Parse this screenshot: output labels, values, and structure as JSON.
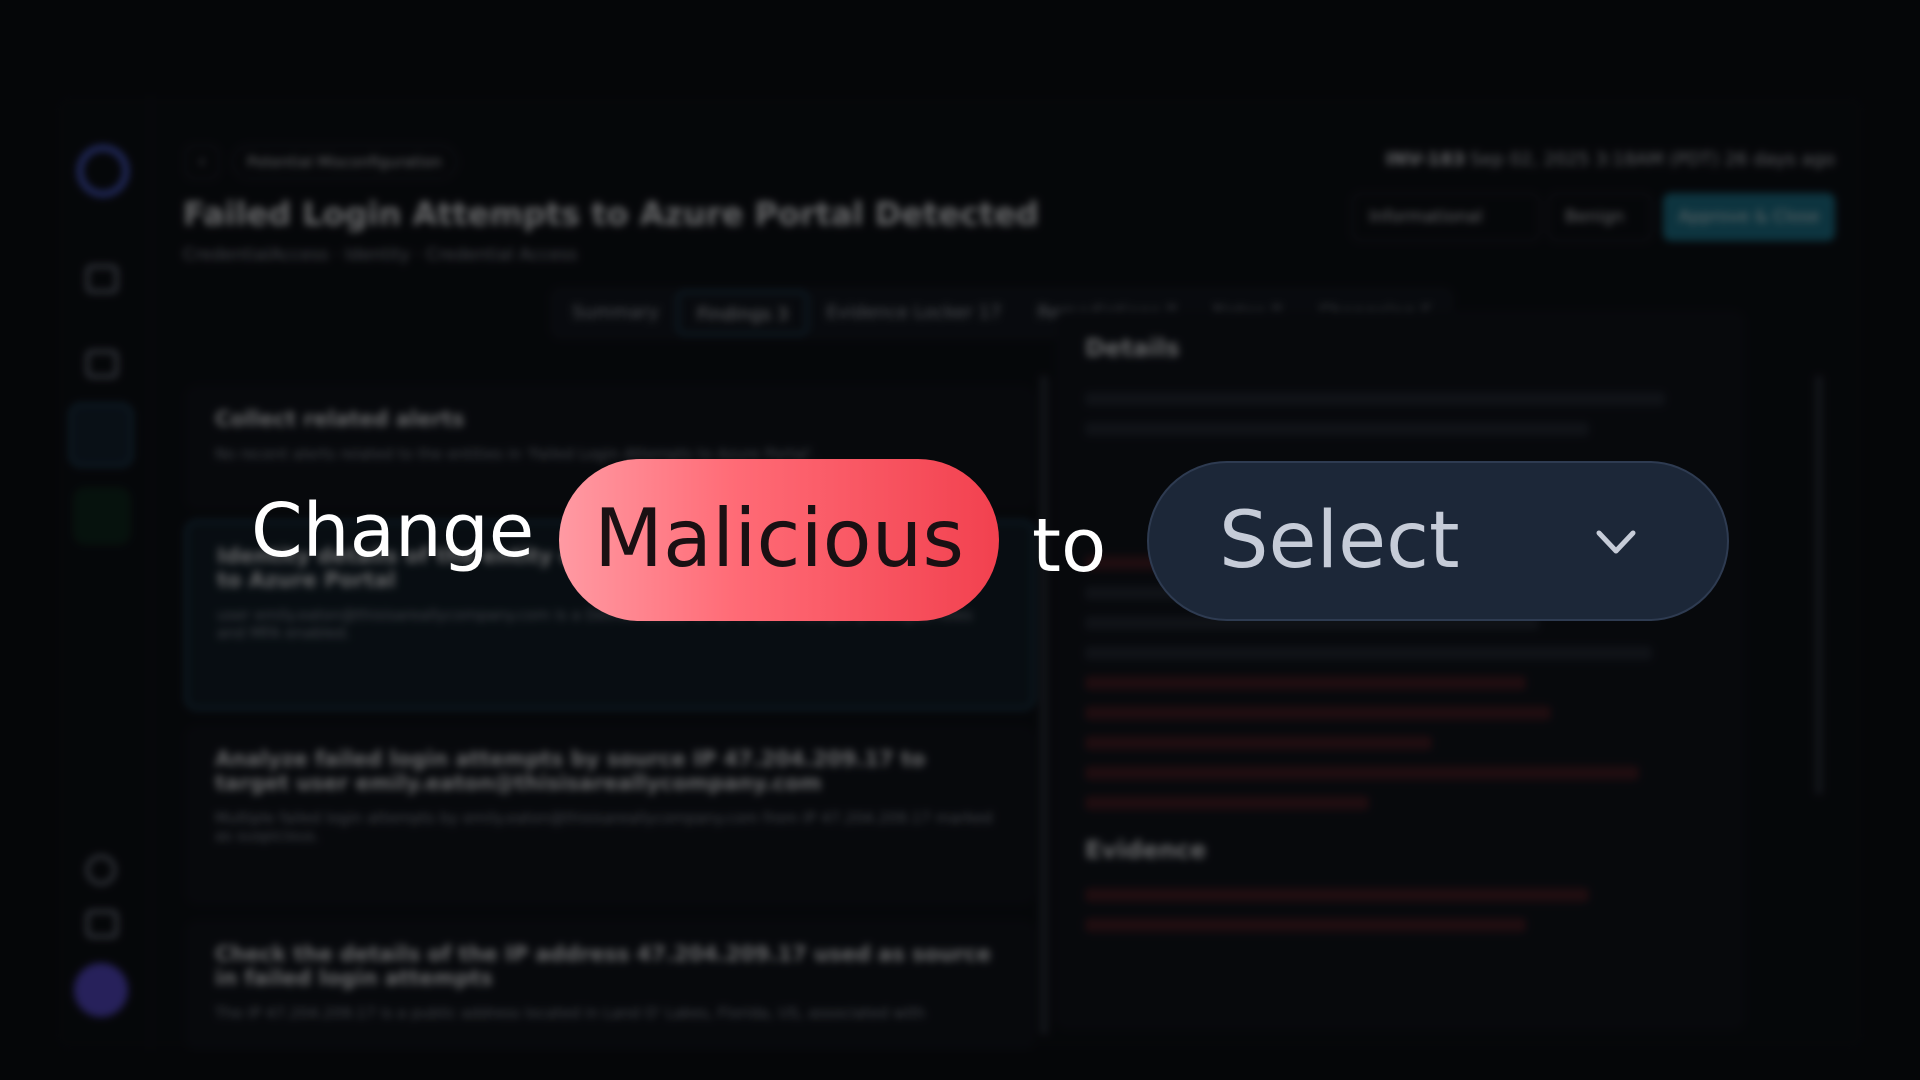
{
  "background_app": {
    "page": {
      "tag": "Potential Misconfiguration",
      "title": "Failed Login Attempts to Azure Portal Detected",
      "subtitle": "CredentialAccess · Identity · Credential Access",
      "severity": "INV-183",
      "date": "Sep 02, 2025 3:18AM (PDT) 26 days ago",
      "dropdown_1": "Informational",
      "dropdown_2": "Benign",
      "primary_button": "Approve & Close"
    },
    "tabs": [
      {
        "label": "Summary"
      },
      {
        "label": "Findings 3"
      },
      {
        "label": "Evidence Locker 17"
      },
      {
        "label": "Remediations 0"
      },
      {
        "label": "Notes 0"
      },
      {
        "label": "Changelog 6"
      }
    ],
    "cards": [
      {
        "title": "Collect related alerts",
        "body": "No recent alerts related to the entities in 'Failed Login Attempts to Azure Portal'."
      },
      {
        "title": "Identity details of the entity emily.eaton — failed login attempts to Azure Portal",
        "body": "user emily.eaton@thisisareallycompany.com is a Detroit-based VP of IT with multiple privileged roles and MFA enabled."
      },
      {
        "title": "Analyze failed login attempts by source IP 47.204.209.17 to target user emily.eaton@thisisareallycompany.com",
        "body": "Multiple failed login attempts by emily.eaton@thisisareallycompany.com from IP 47.204.209.17 marked as suspicious."
      },
      {
        "title": "Check the details of the IP address 47.204.209.17 used as source in failed login attempts",
        "body": "The IP 47.204.209.17 is a public address located in Land O' Lakes, Florida, US, associated with"
      }
    ],
    "details": {
      "heading": "Details",
      "evidence_heading": "Evidence"
    }
  },
  "overlay": {
    "change_label": "Change",
    "from_value": "Malicious",
    "to_label": "to",
    "select_placeholder": "Select"
  },
  "colors": {
    "malicious_gradient_start": "#ff9aa3",
    "malicious_gradient_end": "#f2414f",
    "select_bg": "#1c2738",
    "page_bg": "#050608"
  },
  "icons": {
    "select_chevron": "chevron-down-icon"
  }
}
